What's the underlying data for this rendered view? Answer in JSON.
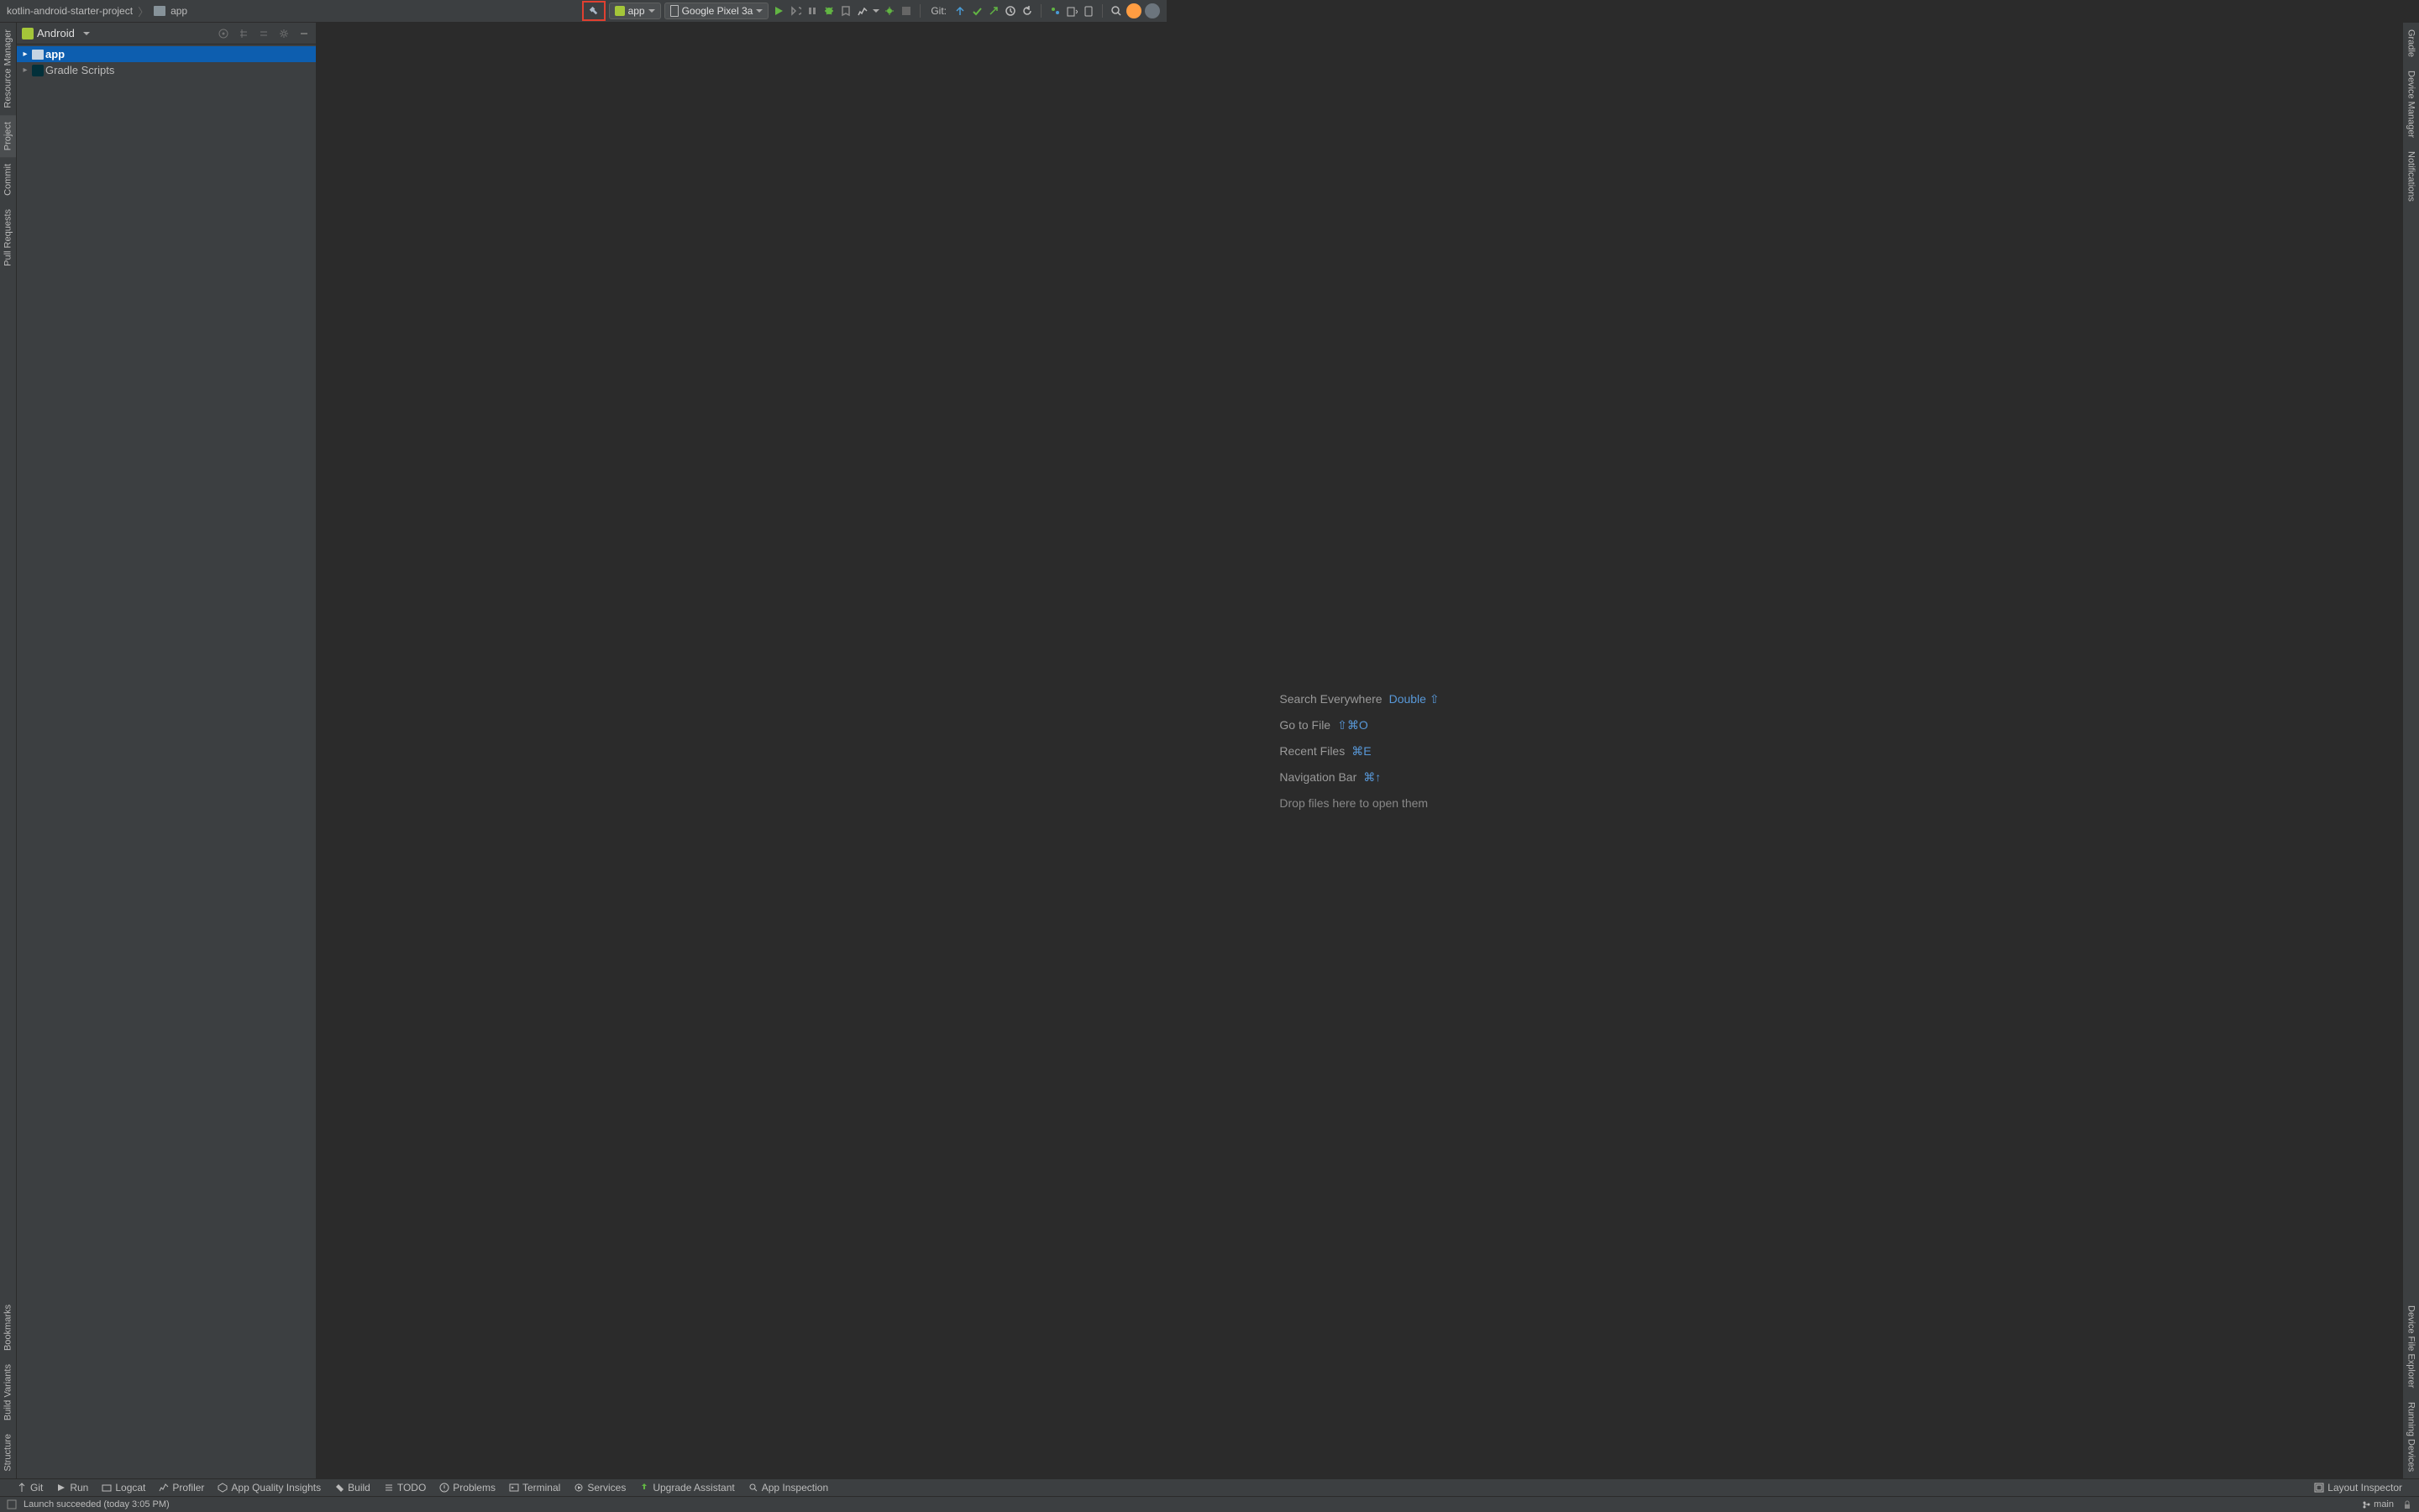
{
  "breadcrumb": {
    "project": "kotlin-android-starter-project",
    "module": "app"
  },
  "toolbar": {
    "run_config": "app",
    "device": "Google Pixel 3a",
    "git_label": "Git:"
  },
  "project_panel": {
    "title": "Android",
    "tree": {
      "app": "app",
      "gradle_scripts": "Gradle Scripts"
    }
  },
  "left_rail": {
    "resource_manager": "Resource Manager",
    "project": "Project",
    "commit": "Commit",
    "pull_requests": "Pull Requests",
    "bookmarks": "Bookmarks",
    "build_variants": "Build Variants",
    "structure": "Structure"
  },
  "right_rail": {
    "gradle": "Gradle",
    "device_manager": "Device Manager",
    "notifications": "Notifications",
    "device_file_explorer": "Device File Explorer",
    "running_devices": "Running Devices"
  },
  "editor_hints": {
    "search_label": "Search Everywhere",
    "search_key": "Double ⇧",
    "goto_label": "Go to File",
    "goto_key": "⇧⌘O",
    "recent_label": "Recent Files",
    "recent_key": "⌘E",
    "nav_label": "Navigation Bar",
    "nav_key": "⌘↑",
    "drop": "Drop files here to open them"
  },
  "bottom_tabs": {
    "git": "Git",
    "run": "Run",
    "logcat": "Logcat",
    "profiler": "Profiler",
    "app_quality": "App Quality Insights",
    "build": "Build",
    "todo": "TODO",
    "problems": "Problems",
    "terminal": "Terminal",
    "services": "Services",
    "upgrade": "Upgrade Assistant",
    "app_inspection": "App Inspection",
    "layout_inspector": "Layout Inspector"
  },
  "status_bar": {
    "message": "Launch succeeded (today 3:05 PM)",
    "branch": "main"
  }
}
